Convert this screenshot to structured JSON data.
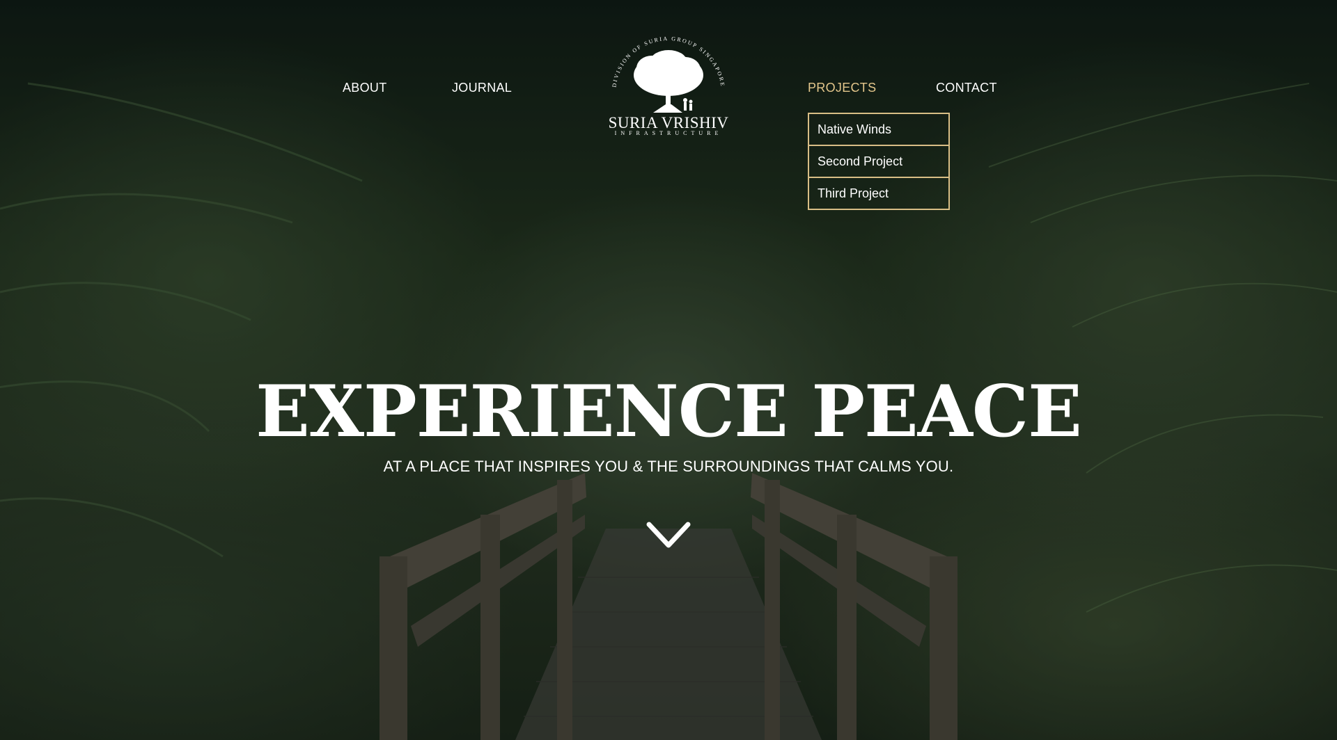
{
  "nav": {
    "about": "ABOUT",
    "journal": "JOURNAL",
    "projects": "PROJECTS",
    "contact": "CONTACT",
    "active": "PROJECTS"
  },
  "logo": {
    "arc_text": "DIVISION OF SURIA GROUP SINGAPORE",
    "name": "SURIA VRISHIV",
    "subtitle": "INFRASTRUCTURE"
  },
  "projects_menu": {
    "items": [
      "Native Winds",
      "Second Project",
      "Third Project"
    ]
  },
  "hero": {
    "headline": "EXPERIENCE PEACE",
    "tagline": "AT A PLACE THAT INSPIRES YOU & THE SURROUNDINGS THAT CALMS YOU.",
    "scroll_icon": "chevron-down-icon"
  },
  "colors": {
    "accent": "#d9be86",
    "active_link": "#e4c78c",
    "text": "#ffffff"
  }
}
